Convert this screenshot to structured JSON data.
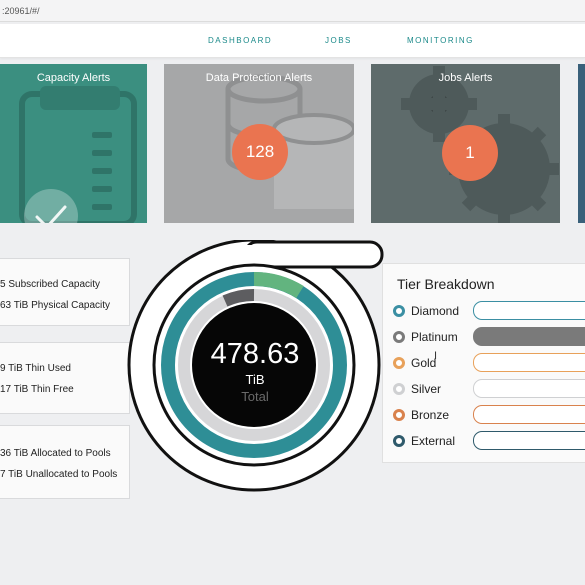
{
  "browser": {
    "url": ":20961/#/"
  },
  "nav": {
    "items": [
      "DASHBOARD",
      "JOBS",
      "MONITORING"
    ]
  },
  "tiles": [
    {
      "title": "Capacity Alerts",
      "status": "ok"
    },
    {
      "title": "Data Protection Alerts",
      "count": "128"
    },
    {
      "title": "Jobs Alerts",
      "count": "1"
    }
  ],
  "capacity": {
    "subscribed": "5 Subscribed Capacity",
    "physical": "63 TiB Physical Capacity",
    "thin_used": "9 TiB Thin Used",
    "thin_free": "17 TiB Thin Free",
    "allocated": "36 TiB Allocated to Pools",
    "unallocated": "7 TiB Unallocated to Pools"
  },
  "gauge": {
    "value": "478.63",
    "unit": "TiB",
    "label": "Total"
  },
  "tier_breakdown": {
    "title": "Tier Breakdown",
    "tiers": [
      {
        "name": "Diamond",
        "color": "#3b8fa3",
        "fill": 0
      },
      {
        "name": "Platinum",
        "color": "#7a7a7a",
        "fill": 1
      },
      {
        "name": "Gold",
        "color": "#e8a15a",
        "fill": 0
      },
      {
        "name": "Silver",
        "color": "#cfd0d2",
        "fill": 0
      },
      {
        "name": "Bronze",
        "color": "#d9824d",
        "fill": 0
      },
      {
        "name": "External",
        "color": "#2f5a6b",
        "fill": 0
      }
    ]
  },
  "colors": {
    "accent": "#1c8a8a",
    "badge": "#ea7450",
    "tile_green": "#3b8f80",
    "tile_gray": "#a6a7a8",
    "tile_slate": "#5e6b6b"
  }
}
